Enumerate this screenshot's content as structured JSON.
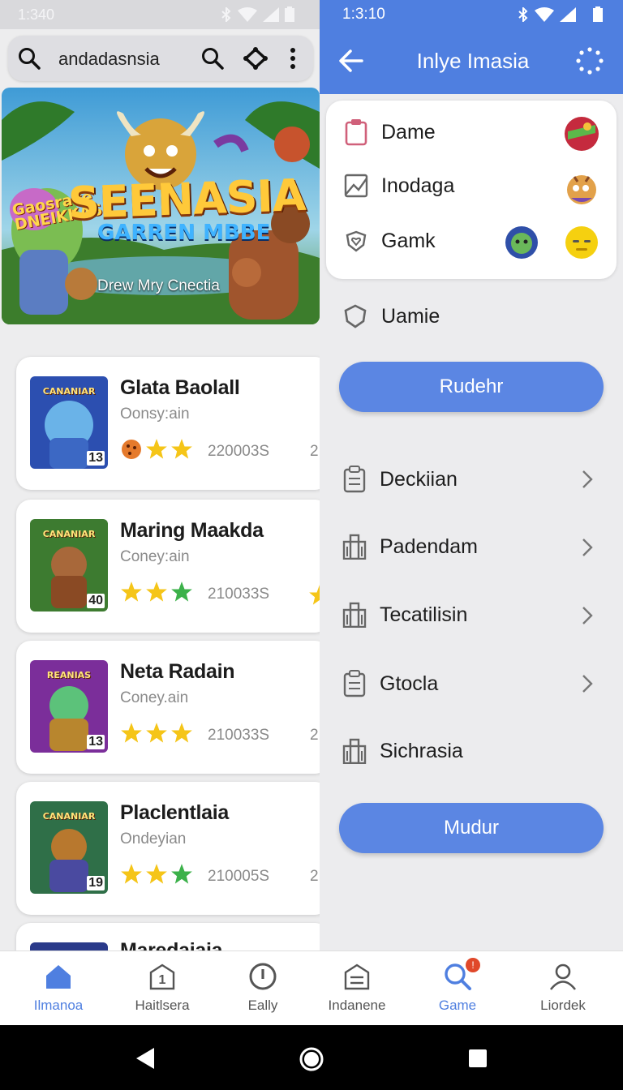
{
  "left_status": {
    "time": "1:340"
  },
  "search": {
    "query": "andadasnsia"
  },
  "banner": {
    "logo_text": "Gaosrake DNEIKKAS",
    "title": "SEENASIA",
    "subtitle": "GARREN MBBE",
    "caption": "Drew Mry Cnectia"
  },
  "games": [
    {
      "title": "Glata Baolall",
      "developer": "Oonsy:ain",
      "count": "220003S",
      "trunc": "2",
      "badge": "13",
      "thumb_banner": "CANANIAR",
      "colors": [
        "#2c4fb0",
        "#6ab3e8"
      ]
    },
    {
      "title": "Maring Maakda",
      "developer": "Coney:ain",
      "count": "210033S",
      "trunc": "",
      "badge": "40",
      "thumb_banner": "CANANIAR",
      "colors": [
        "#3d7b30",
        "#9bc76a"
      ]
    },
    {
      "title": "Neta Radain",
      "developer": "Coney.ain",
      "count": "210033S",
      "trunc": "2",
      "badge": "13",
      "thumb_banner": "REANIAS",
      "colors": [
        "#7b2e9a",
        "#d765c7"
      ]
    },
    {
      "title": "Placlentlaia",
      "developer": "Ondeyian",
      "count": "210005S",
      "trunc": "2",
      "badge": "19",
      "thumb_banner": "CANANIAR",
      "colors": [
        "#2f6f48",
        "#8ac06a"
      ]
    },
    {
      "title": "Maredaiaia",
      "developer": "",
      "count": "",
      "trunc": "",
      "badge": "",
      "thumb_banner": "",
      "colors": [
        "#2a3a8a",
        "#4a6ad0"
      ]
    }
  ],
  "right_status": {
    "time": "1:3:10"
  },
  "header": {
    "title": "Inlye Imasia"
  },
  "menu_card": [
    {
      "label": "Dame",
      "icon": "clipboard-icon"
    },
    {
      "label": "Inodaga",
      "icon": "image-icon"
    },
    {
      "label": "Gamk",
      "icon": "heart-shield-icon"
    }
  ],
  "uamie": {
    "label": "Uamie"
  },
  "buttons": {
    "rudehr": "Rudehr",
    "mudur": "Mudur"
  },
  "list_items": [
    {
      "label": "Deckiian",
      "icon": "clipboard-icon"
    },
    {
      "label": "Padendam",
      "icon": "building-icon"
    },
    {
      "label": "Tecatilisin",
      "icon": "building-icon"
    },
    {
      "label": "Gtocla",
      "icon": "clipboard-icon"
    },
    {
      "label": "Sichrasia",
      "icon": "building-icon"
    }
  ],
  "nav": [
    {
      "label": "Ilmanoa",
      "icon": "home-icon"
    },
    {
      "label": "Haitlsera",
      "icon": "info-shield-icon"
    },
    {
      "label": "Eally",
      "icon": "clock-icon"
    },
    {
      "label": "Indanene",
      "icon": "archive-icon"
    },
    {
      "label": "Game",
      "icon": "search-icon",
      "badge": "!"
    },
    {
      "label": "Liordek",
      "icon": "profile-icon"
    }
  ],
  "colors": {
    "accent": "#4f7fe0",
    "button": "#5b86e3",
    "badge": "#e0482a",
    "star": "#f5c518"
  }
}
